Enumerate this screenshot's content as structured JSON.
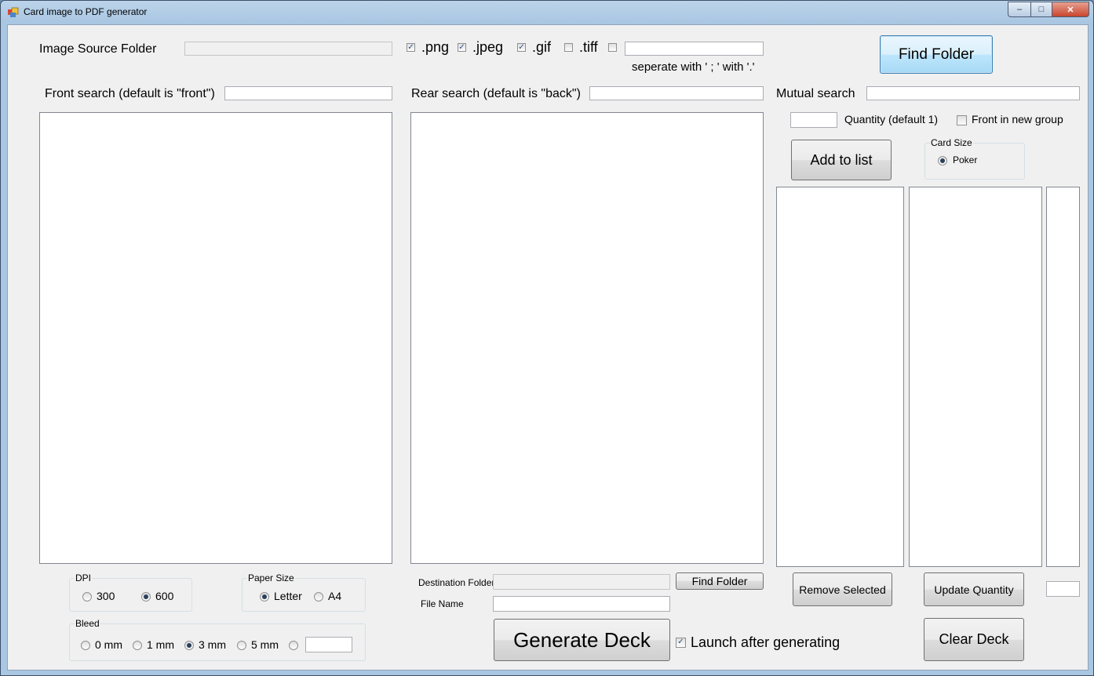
{
  "window": {
    "title": "Card image to PDF generator",
    "caption": {
      "minimize": "–",
      "maximize": "□",
      "close": "✕"
    }
  },
  "source": {
    "label": "Image Source Folder",
    "path_value": "",
    "ext_png": ".png",
    "ext_jpeg": ".jpeg",
    "ext_gif": ".gif",
    "ext_tiff": ".tiff",
    "custom_ext_value": "",
    "separator_hint": "seperate with ' ; ' with '.'",
    "find_folder_button": "Find Folder"
  },
  "extensions_checked": {
    "png": true,
    "jpeg": true,
    "gif": true,
    "tiff": false,
    "custom": false
  },
  "front": {
    "label": "Front search (default is \"front\")",
    "value": ""
  },
  "rear": {
    "label": "Rear search (default is \"back\")",
    "value": ""
  },
  "mutual": {
    "label": "Mutual search",
    "value": ""
  },
  "quantity": {
    "label": "Quantity (default 1)",
    "value": ""
  },
  "front_new_group": {
    "label": "Front in new group",
    "checked": false
  },
  "add_to_list_button": "Add to list",
  "card_size": {
    "title": "Card Size",
    "options": [
      "Poker"
    ],
    "selected": "Poker"
  },
  "deck": {
    "remove_selected_button": "Remove Selected",
    "update_quantity_button": "Update Quantity",
    "quantity_value": "",
    "clear_deck_button": "Clear Deck"
  },
  "dpi": {
    "title": "DPI",
    "options": [
      "300",
      "600"
    ],
    "selected": "600"
  },
  "paper_size": {
    "title": "Paper Size",
    "options": [
      "Letter",
      "A4"
    ],
    "selected": "Letter"
  },
  "bleed": {
    "title": "Bleed",
    "options": [
      "0 mm",
      "1 mm",
      "3 mm",
      "5 mm"
    ],
    "selected": "3 mm",
    "custom_value": ""
  },
  "output": {
    "destination_label": "Destination Folder",
    "destination_value": "",
    "find_folder_button": "Find Folder",
    "file_name_label": "File Name",
    "file_name_value": "",
    "generate_button": "Generate Deck",
    "launch_label": "Launch after generating",
    "launch_checked": true
  }
}
